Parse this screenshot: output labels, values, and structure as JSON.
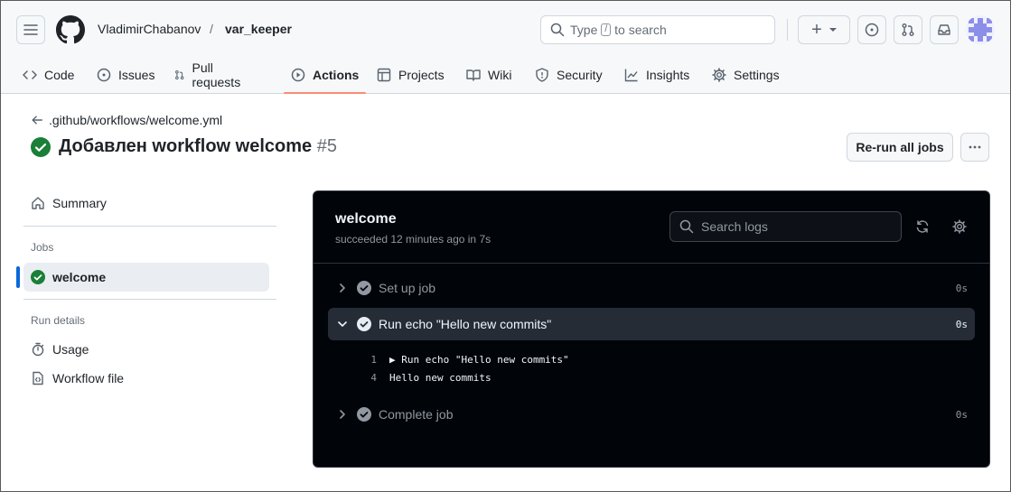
{
  "header": {
    "owner": "VladimirChabanov",
    "separator": "/",
    "repo": "var_keeper",
    "search_before": "Type",
    "search_key": "/",
    "search_after": "to search",
    "plus_label": "+"
  },
  "tabs": [
    {
      "label": "Code",
      "icon": "code-icon"
    },
    {
      "label": "Issues",
      "icon": "issue-opened-icon"
    },
    {
      "label": "Pull requests",
      "icon": "git-pull-request-icon"
    },
    {
      "label": "Actions",
      "icon": "play-icon",
      "active": true
    },
    {
      "label": "Projects",
      "icon": "table-icon"
    },
    {
      "label": "Wiki",
      "icon": "book-icon"
    },
    {
      "label": "Security",
      "icon": "shield-icon"
    },
    {
      "label": "Insights",
      "icon": "graph-icon"
    },
    {
      "label": "Settings",
      "icon": "gear-icon"
    }
  ],
  "run": {
    "back_link": ".github/workflows/welcome.yml",
    "title": "Добавлен workflow welcome",
    "number": "#5",
    "rerun_label": "Re-run all jobs",
    "status_color": "#1a7f37"
  },
  "sidebar": {
    "summary": "Summary",
    "jobs_heading": "Jobs",
    "job": "welcome",
    "run_details_heading": "Run details",
    "usage": "Usage",
    "workflow_file": "Workflow file"
  },
  "log_panel": {
    "job_name": "welcome",
    "status_line": "succeeded 12 minutes ago in 7s",
    "search_placeholder": "Search logs",
    "steps": [
      {
        "name": "Set up job",
        "duration": "0s",
        "expanded": false
      },
      {
        "name": "Run echo \"Hello new commits\"",
        "duration": "0s",
        "expanded": true
      },
      {
        "name": "Complete job",
        "duration": "0s",
        "expanded": false
      }
    ],
    "log_lines": [
      {
        "n": "1",
        "text": "▶ Run echo \"Hello new commits\""
      },
      {
        "n": "4",
        "text": "Hello new commits"
      }
    ]
  }
}
